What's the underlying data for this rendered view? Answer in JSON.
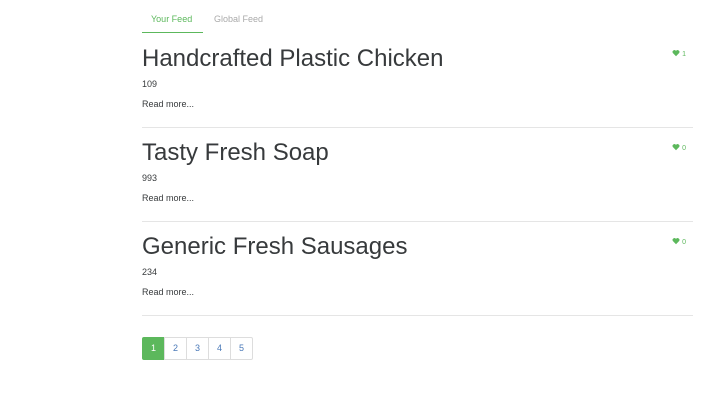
{
  "feed_tabs": [
    {
      "label": "Your Feed",
      "active": true
    },
    {
      "label": "Global Feed",
      "active": false
    }
  ],
  "articles": [
    {
      "title": "Handcrafted Plastic Chicken",
      "description": "109",
      "read_more": "Read more...",
      "likes": "1"
    },
    {
      "title": "Tasty Fresh Soap",
      "description": "993",
      "read_more": "Read more...",
      "likes": "0"
    },
    {
      "title": "Generic Fresh Sausages",
      "description": "234",
      "read_more": "Read more...",
      "likes": "0"
    }
  ],
  "pagination": {
    "pages": [
      "1",
      "2",
      "3",
      "4",
      "5"
    ],
    "current": "1"
  },
  "colors": {
    "accent": "#5cb85c",
    "text": "#373a3c",
    "muted": "#aaaaaa",
    "link": "#4a79b8",
    "divider": "#e5e5e5"
  },
  "icons": {
    "like": "heart-icon"
  }
}
